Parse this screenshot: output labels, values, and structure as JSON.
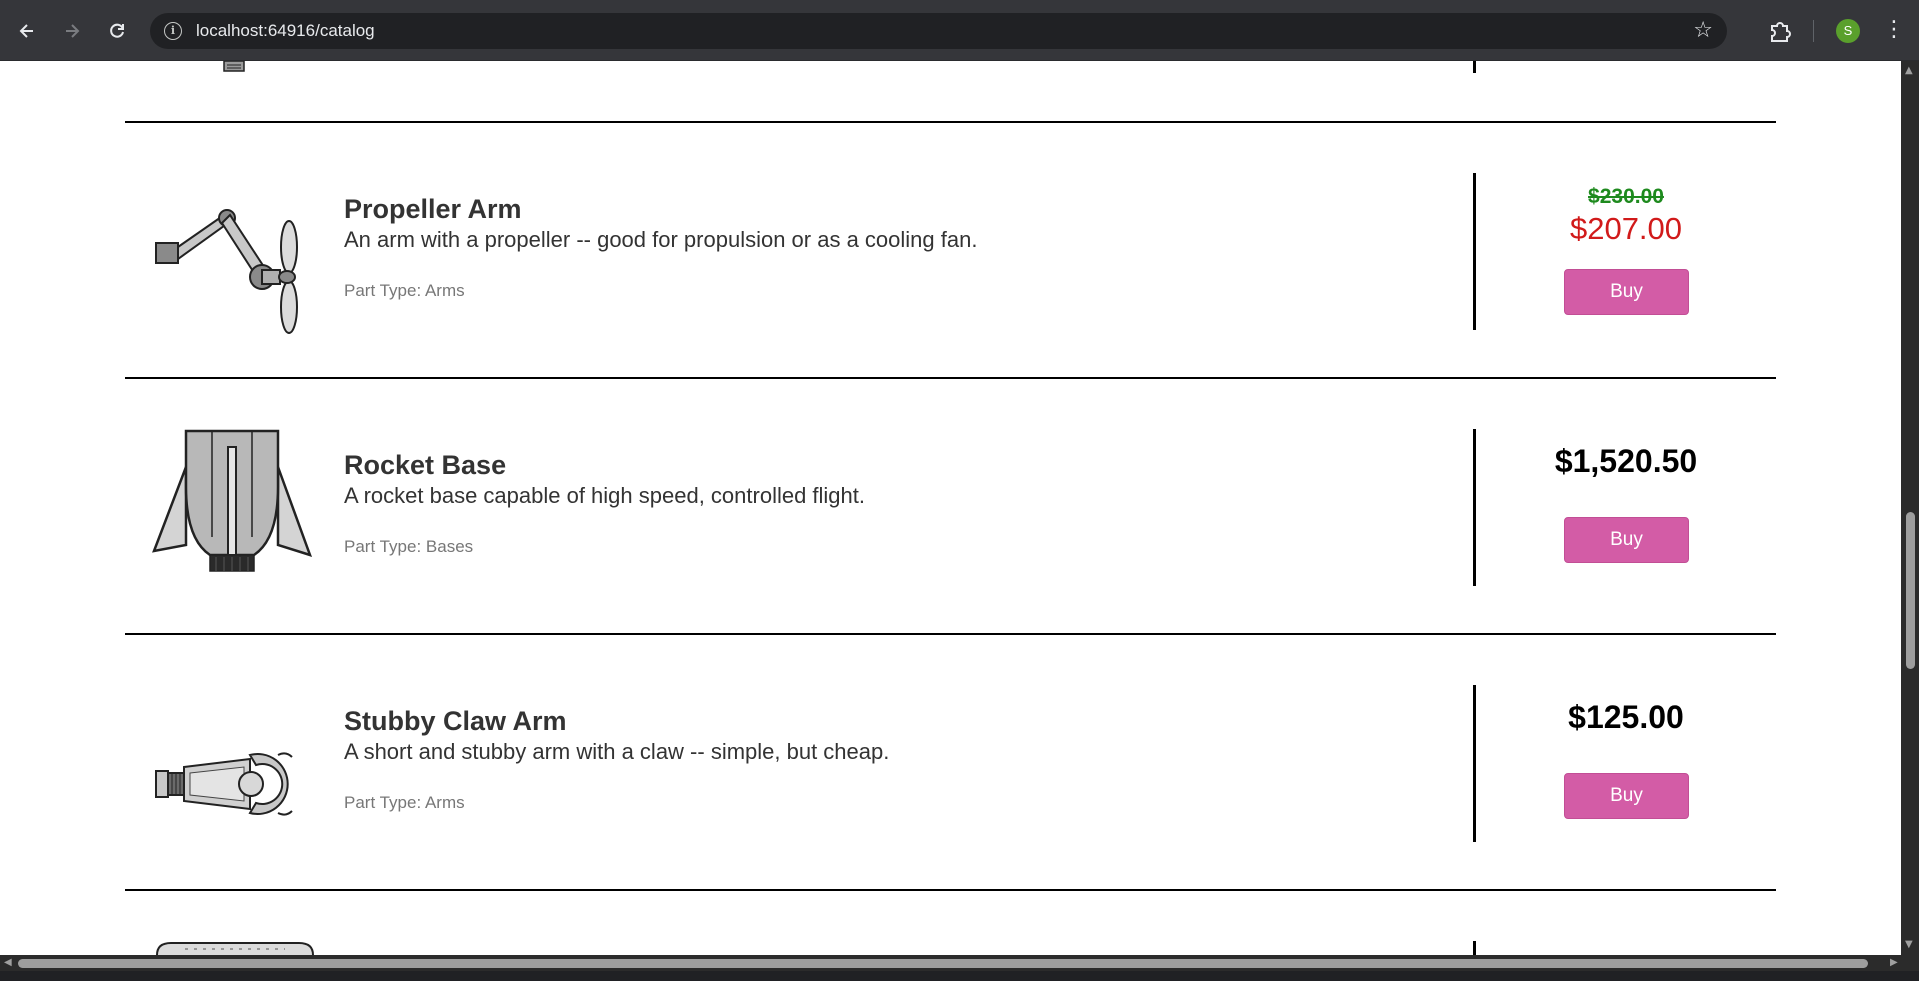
{
  "browser": {
    "url": "localhost:64916/catalog",
    "avatar_letter": "S",
    "back_icon": "arrow-left-icon",
    "forward_icon": "arrow-right-icon",
    "reload_icon": "reload-icon",
    "bookmark_icon": "star-icon",
    "extensions_icon": "puzzle-icon",
    "menu_icon": "kebab-menu-icon"
  },
  "products": [
    {
      "name": "Propeller Arm",
      "description": "An arm with a propeller -- good for propulsion or as a cooling fan.",
      "part_type": "Part Type: Arms",
      "old_price": "$230.00",
      "price": "$207.00",
      "on_sale": true,
      "buy_label": "Buy"
    },
    {
      "name": "Rocket Base",
      "description": "A rocket base capable of high speed, controlled flight.",
      "part_type": "Part Type: Bases",
      "price": "$1,520.50",
      "on_sale": false,
      "buy_label": "Buy"
    },
    {
      "name": "Stubby Claw Arm",
      "description": "A short and stubby arm with a claw -- simple, but cheap.",
      "part_type": "Part Type: Arms",
      "price": "$125.00",
      "on_sale": false,
      "buy_label": "Buy"
    }
  ],
  "colors": {
    "buy_button": "#d35ca6",
    "sale_price": "#d11a1a",
    "old_price": "#1e8a1e",
    "chrome_bg": "#35363a"
  }
}
